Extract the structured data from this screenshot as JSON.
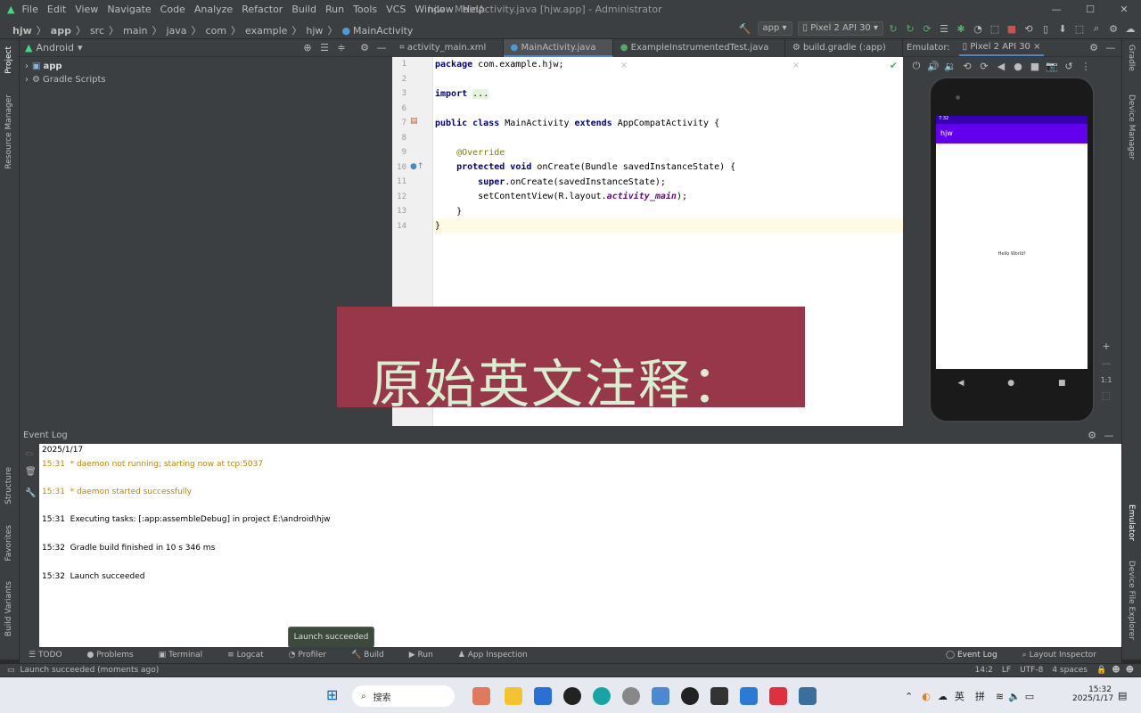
{
  "titlebar": {
    "menu": [
      "File",
      "Edit",
      "View",
      "Navigate",
      "Code",
      "Analyze",
      "Refactor",
      "Build",
      "Run",
      "Tools",
      "VCS",
      "Window",
      "Help"
    ],
    "title": "hjw - MainActivity.java [hjw.app] - Administrator"
  },
  "navbar": {
    "crumbs": [
      "hjw",
      "app",
      "src",
      "main",
      "java",
      "com",
      "example",
      "hjw",
      "MainActivity"
    ],
    "run_config": "app",
    "device": "Pixel 2 API 30"
  },
  "project": {
    "view": "Android",
    "items": [
      "app",
      "Gradle Scripts"
    ]
  },
  "left_tools": [
    "Project",
    "Resource Manager",
    "Structure",
    "Favorites",
    "Build Variants"
  ],
  "right_tools": [
    "Gradle",
    "Device Manager",
    "Emulator",
    "Device File Explorer"
  ],
  "editor": {
    "tabs": [
      "activity_main.xml",
      "MainActivity.java",
      "ExampleInstrumentedTest.java",
      "build.gradle (:app)"
    ],
    "active_tab": "MainActivity.java"
  },
  "emulator": {
    "label": "Emulator:",
    "tab": "Pixel 2 API 30",
    "app_title": "hjw",
    "status_time": "7:32",
    "hello": "Hello World!",
    "zoom": "1:1"
  },
  "eventlog": {
    "title": "Event Log",
    "date": "2025/1/17",
    "lines": [
      {
        "time": "15:31",
        "text": "* daemon not running; starting now at tcp:5037",
        "warn": true
      },
      {
        "time": "15:31",
        "text": "* daemon started successfully",
        "warn": true
      },
      {
        "time": "15:31",
        "text": "Executing tasks: [:app:assembleDebug] in project E:\\android\\hjw",
        "warn": false
      },
      {
        "time": "15:32",
        "text": "Gradle build finished in 10 s 346 ms",
        "warn": false
      },
      {
        "time": "15:32",
        "text": "Launch succeeded",
        "warn": false
      }
    ]
  },
  "bottom_tabs": [
    "TODO",
    "Problems",
    "Terminal",
    "Logcat",
    "Profiler",
    "Build",
    "Run",
    "App Inspection"
  ],
  "bottom_right_tabs": [
    "Event Log",
    "Layout Inspector"
  ],
  "toast": "Launch succeeded",
  "status": {
    "message": "Launch succeeded (moments ago)",
    "position": "14:2",
    "line_sep": "LF",
    "encoding": "UTF-8",
    "indent": "4 spaces"
  },
  "overlay": "原始英文注释：",
  "taskbar": {
    "search": "搜索",
    "tray_lang": "英",
    "tray_ime": "拼",
    "time": "15:32",
    "date": "2025/1/17"
  }
}
